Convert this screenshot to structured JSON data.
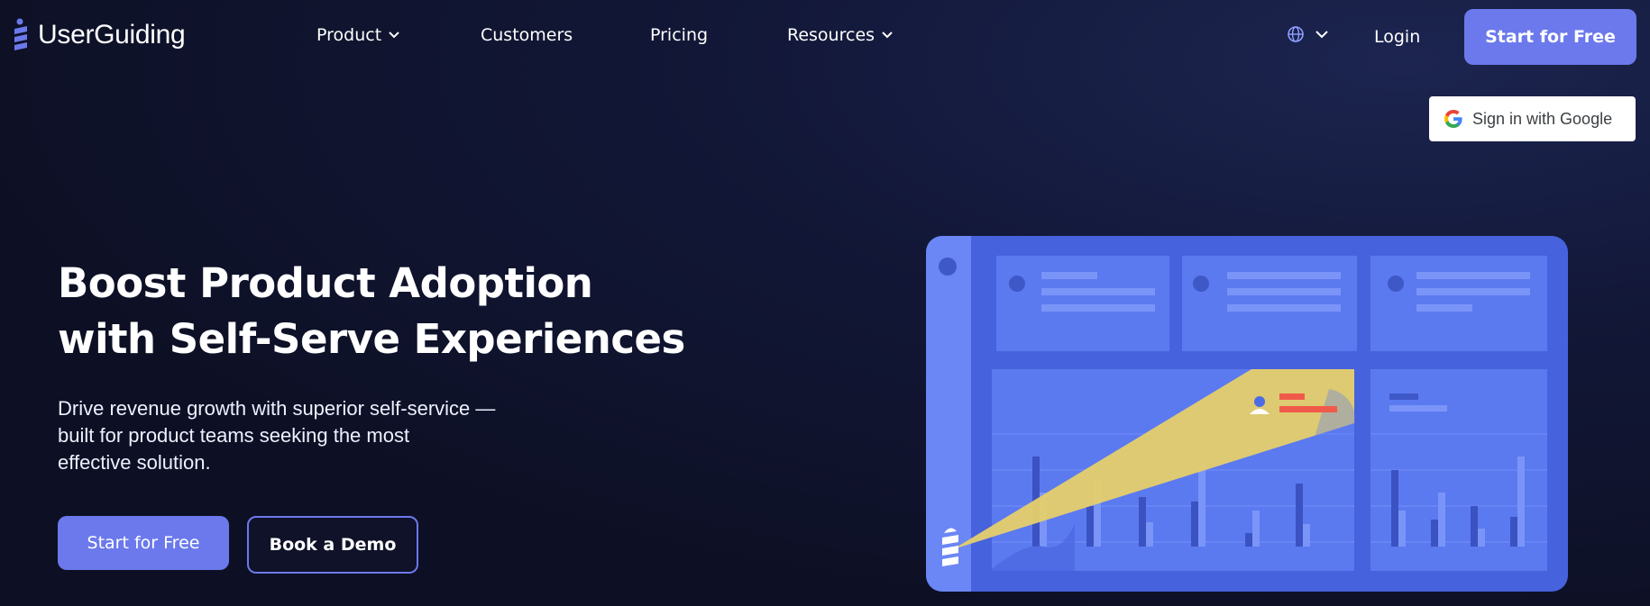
{
  "brand": {
    "name": "UserGuiding",
    "accent": "#6b79ec"
  },
  "nav": {
    "items": [
      {
        "label": "Product",
        "has_dropdown": true
      },
      {
        "label": "Customers",
        "has_dropdown": false
      },
      {
        "label": "Pricing",
        "has_dropdown": false
      },
      {
        "label": "Resources",
        "has_dropdown": true
      }
    ],
    "language_icon": "globe-icon",
    "login_label": "Login",
    "cta_label": "Start for Free"
  },
  "google_signin": {
    "label": "Sign in with Google",
    "icon": "google-g-icon"
  },
  "hero": {
    "title_lines": [
      "Boost Product Adoption",
      "with Self-Serve Experiences"
    ],
    "subtitle_lines": [
      "Drive revenue growth with superior self-service —",
      "built for product teams seeking the most",
      "effective solution."
    ],
    "primary_cta": "Start for Free",
    "secondary_cta": "Book a Demo"
  },
  "illustration": {
    "name": "dashboard-spotlight-illustration",
    "colors": {
      "panel": "#5b7af0",
      "dark_panel": "#4762dd",
      "beam": "#ecd36c",
      "highlight": "#f05a4a"
    }
  }
}
